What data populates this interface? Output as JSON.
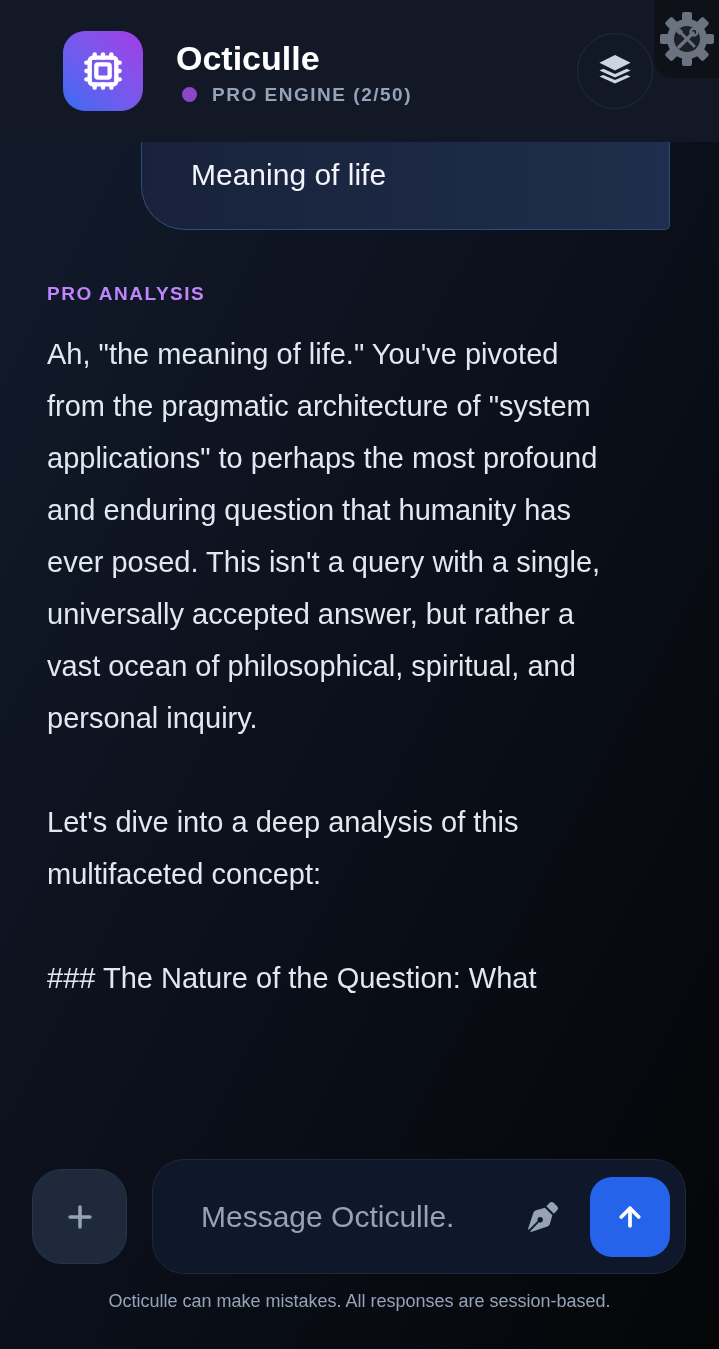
{
  "header": {
    "app_name": "Octiculle",
    "status_label": "PRO ENGINE (2/50)"
  },
  "messages": [
    {
      "kind": "user",
      "text": "Meaning of life"
    },
    {
      "kind": "assistant",
      "label": "PRO ANALYSIS",
      "paragraphs": [
        "Ah, \"the meaning of life.\" You've pivoted from the pragmatic architecture of \"system applications\" to perhaps the most profound and enduring question that humanity has ever posed. This isn't a query with a single, universally accepted answer, but rather a vast ocean of philosophical, spiritual, and personal inquiry.",
        "Let's dive into a deep analysis of this multifaceted concept:",
        "### The Nature of the Question: What"
      ]
    }
  ],
  "composer": {
    "placeholder": "Message Octiculle."
  },
  "footer": {
    "disclaimer": "Octiculle can make mistakes. All responses are session-based."
  }
}
